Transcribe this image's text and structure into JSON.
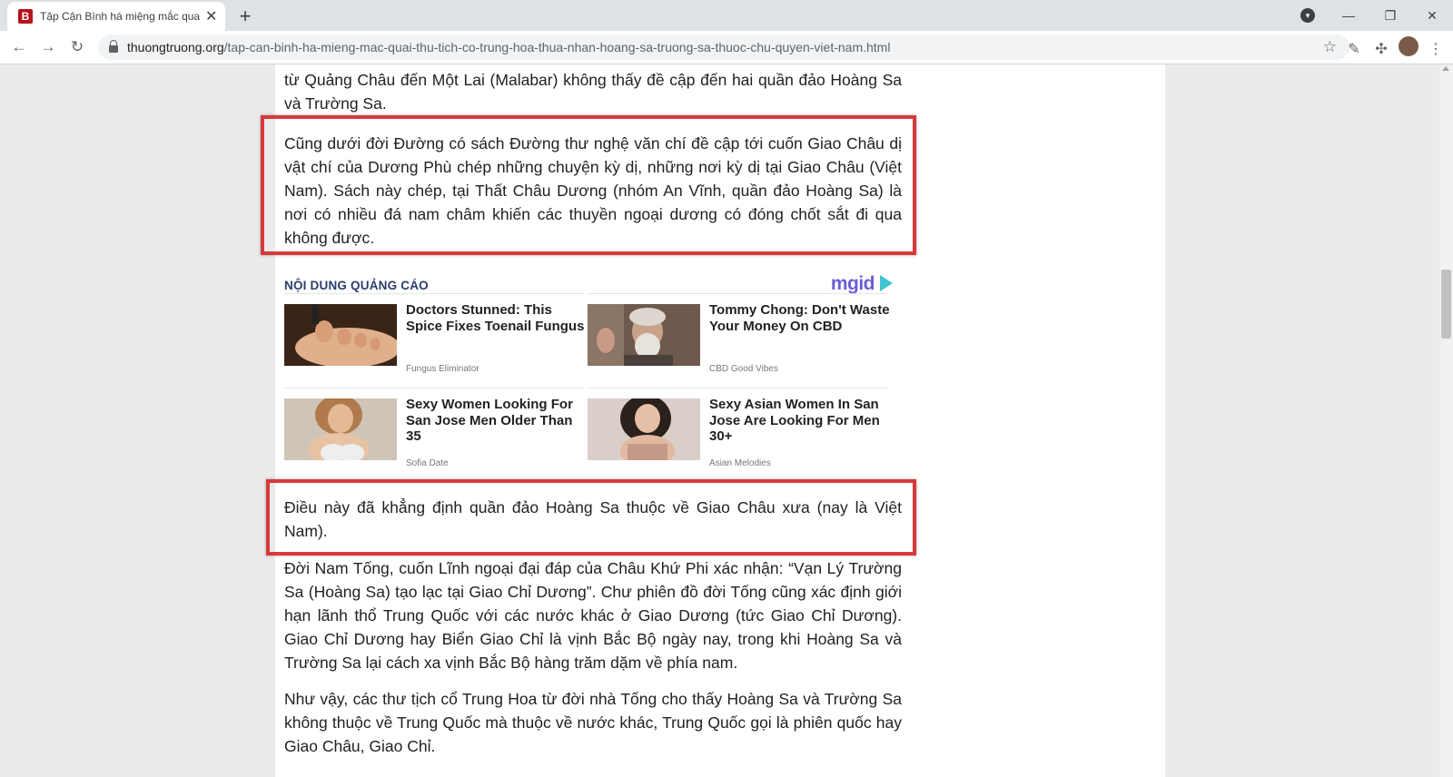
{
  "browser": {
    "tab_title": "Tập Cận Bình há miệng mắc quai thú tịch có Trung Hoa thừa nhận Hoàng Sa",
    "favicon_letter": "B",
    "url_domain": "thuongtruong.org",
    "url_path": "/tap-can-binh-ha-mieng-mac-quai-thu-tich-co-trung-hoa-thua-nhan-hoang-sa-truong-sa-thuoc-chu-quyen-viet-nam.html"
  },
  "article": {
    "para_top": "từ Quảng Châu đến Một Lai (Malabar) không thấy đề cập đến hai quần đảo Hoàng Sa và Trường Sa.",
    "para_highlight_1": "Cũng dưới đời Đường có sách Đường thư nghệ văn chí đề cập tới cuốn Giao Châu dị vật chí của Dương Phù chép những chuyện kỳ dị, những nơi kỳ dị tại Giao Châu (Việt Nam). Sách này chép, tại Thất Châu Dương (nhóm An Vĩnh, quần đảo Hoàng Sa) là nơi có nhiều đá nam châm khiến các thuyền ngoại dương có đóng chốt sắt đi qua không được.",
    "para_highlight_2": "Điều này đã khẳng định quần đảo Hoàng Sa thuộc về Giao Châu xưa (nay là Việt Nam).",
    "para_3": "Đời Nam Tống, cuốn Lĩnh ngoại đại đáp của Châu Khứ Phi xác nhận: “Vạn Lý Trường Sa (Hoàng Sa) tạo lạc tại Giao Chỉ Dương”. Chư phiên đồ đời Tống cũng xác định giới hạn lãnh thổ Trung Quốc với các nước khác ở Giao Dương (tức Giao Chỉ Dương). Giao Chỉ Dương hay Biển Giao Chỉ là vịnh Bắc Bộ ngày nay, trong khi Hoàng Sa và Trường Sa lại cách xa vịnh Bắc Bộ hàng trăm dặm về phía nam.",
    "para_4": "Như vậy, các thư tịch cổ Trung Hoa từ đời nhà Tống cho thấy Hoàng Sa và Trường Sa không thuộc về Trung Quốc mà thuộc về nước khác, Trung Quốc gọi là phiên quốc hay Giao Châu, Giao Chỉ."
  },
  "ad": {
    "header": "NỘI DUNG QUẢNG CÁO",
    "logo": "mgid",
    "items": [
      {
        "title": "Doctors Stunned: This Spice Fixes Toenail Fungus",
        "source": "Fungus Eliminator"
      },
      {
        "title": "Tommy Chong: Don't Waste Your Money On CBD",
        "source": "CBD Good Vibes"
      },
      {
        "title": "Sexy Women Looking For San Jose Men Older Than 35",
        "source": "Sofia Date"
      },
      {
        "title": "Sexy Asian Women In San Jose Are Looking For Men 30+",
        "source": "Asian Melodies"
      }
    ]
  },
  "colors": {
    "highlight_border": "#d9393a",
    "ad_header": "#2a3d6d",
    "mgid_logo": "#6a5dd8"
  }
}
